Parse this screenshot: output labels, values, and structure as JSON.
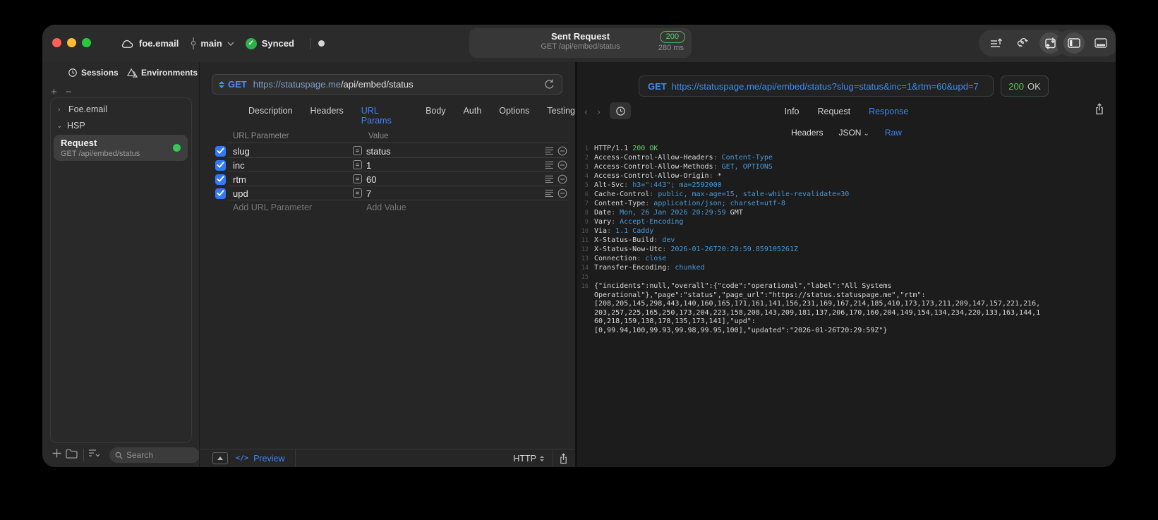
{
  "titlebar": {
    "project": "foe.email",
    "branch": "main",
    "sync": "Synced",
    "request_title": "Sent Request",
    "request_subtitle": "GET /api/embed/status",
    "status_code": "200",
    "duration": "280 ms"
  },
  "sidebar": {
    "tabs": [
      {
        "label": "Sessions",
        "active": true
      },
      {
        "label": "Environments",
        "active": false
      }
    ],
    "tree": {
      "collapsed_item": "Foe.email",
      "expanded_item": "HSP",
      "request": {
        "title": "Request",
        "subtitle": "GET /api/embed/status"
      }
    },
    "search_placeholder": "Search"
  },
  "request_editor": {
    "method": "GET",
    "url_host": "https://statuspage.me",
    "url_path": "/api/embed/status",
    "tabs": [
      {
        "label": "Description"
      },
      {
        "label": "Headers"
      },
      {
        "label": "URL Params",
        "active": true
      },
      {
        "label": "Body"
      },
      {
        "label": "Auth"
      },
      {
        "label": "Options"
      },
      {
        "label": "Testing"
      }
    ],
    "params": {
      "col_name": "URL Parameter",
      "col_value": "Value",
      "rows": [
        {
          "name": "slug",
          "value": "status",
          "checked": true
        },
        {
          "name": "inc",
          "value": "1",
          "checked": true
        },
        {
          "name": "rtm",
          "value": "60",
          "checked": true
        },
        {
          "name": "upd",
          "value": "7",
          "checked": true
        }
      ],
      "add_name": "Add URL Parameter",
      "add_value": "Add Value"
    },
    "footer": {
      "code_glyph": "</>",
      "preview": "Preview",
      "protocol": "HTTP"
    }
  },
  "response_viewer": {
    "method": "GET",
    "url": "https://statuspage.me/api/embed/status?slug=status&inc=1&rtm=60&upd=7",
    "status_code": "200",
    "status_text": "OK",
    "tabs": [
      {
        "label": "Info"
      },
      {
        "label": "Request"
      },
      {
        "label": "Response",
        "active": true
      }
    ],
    "view_tabs": [
      {
        "label": "Headers"
      },
      {
        "label": "JSON",
        "chevron": true
      },
      {
        "label": "Raw",
        "active": true
      }
    ],
    "lines": [
      {
        "n": "1",
        "parts": [
          [
            "p",
            "HTTP/1.1 "
          ],
          [
            "g",
            "200 OK"
          ]
        ]
      },
      {
        "n": "2",
        "parts": [
          [
            "p",
            "Access-Control-Allow-Headers"
          ],
          [
            "d",
            ": "
          ],
          [
            "b",
            "Content-Type"
          ]
        ]
      },
      {
        "n": "3",
        "parts": [
          [
            "p",
            "Access-Control-Allow-Methods"
          ],
          [
            "d",
            ": "
          ],
          [
            "b",
            "GET, OPTIONS"
          ]
        ]
      },
      {
        "n": "4",
        "parts": [
          [
            "p",
            "Access-Control-Allow-Origin"
          ],
          [
            "d",
            ": "
          ],
          [
            "p",
            "*"
          ]
        ]
      },
      {
        "n": "5",
        "parts": [
          [
            "p",
            "Alt-Svc"
          ],
          [
            "d",
            ": "
          ],
          [
            "b",
            "h3=\":443\"; ma=2592000"
          ]
        ]
      },
      {
        "n": "6",
        "parts": [
          [
            "p",
            "Cache-Control"
          ],
          [
            "d",
            ": "
          ],
          [
            "b",
            "public, max-age=15, stale-while-revalidate=30"
          ]
        ]
      },
      {
        "n": "7",
        "parts": [
          [
            "p",
            "Content-Type"
          ],
          [
            "d",
            ": "
          ],
          [
            "b",
            "application/json; charset=utf-8"
          ]
        ]
      },
      {
        "n": "8",
        "parts": [
          [
            "p",
            "Date"
          ],
          [
            "d",
            ": "
          ],
          [
            "b",
            "Mon, 26 Jan 2026 20:29:59"
          ],
          [
            "p",
            " GMT"
          ]
        ]
      },
      {
        "n": "9",
        "parts": [
          [
            "p",
            "Vary"
          ],
          [
            "d",
            ": "
          ],
          [
            "b",
            "Accept-Encoding"
          ]
        ]
      },
      {
        "n": "10",
        "parts": [
          [
            "p",
            "Via"
          ],
          [
            "d",
            ": "
          ],
          [
            "b",
            "1.1 Caddy"
          ]
        ]
      },
      {
        "n": "11",
        "parts": [
          [
            "p",
            "X-Status-Build"
          ],
          [
            "d",
            ": "
          ],
          [
            "b",
            "dev"
          ]
        ]
      },
      {
        "n": "12",
        "parts": [
          [
            "p",
            "X-Status-Now-Utc"
          ],
          [
            "d",
            ": "
          ],
          [
            "b",
            "2026-01-26T20:29:59.859105261Z"
          ]
        ]
      },
      {
        "n": "13",
        "parts": [
          [
            "p",
            "Connection"
          ],
          [
            "d",
            ": "
          ],
          [
            "b",
            "close"
          ]
        ]
      },
      {
        "n": "14",
        "parts": [
          [
            "p",
            "Transfer-Encoding"
          ],
          [
            "d",
            ": "
          ],
          [
            "b",
            "chunked"
          ]
        ]
      },
      {
        "n": "15",
        "parts": []
      },
      {
        "n": "16",
        "wrap": [
          "{\"incidents\":null,\"overall\":{\"code\":\"operational\",\"label\":\"All Systems",
          "Operational\"},\"page\":\"status\",\"page_url\":\"https://status.statuspage.me\",\"rtm\":",
          "[208,205,145,298,443,140,160,165,171,161,141,156,231,169,167,214,185,410,173,173,211,209,147,157,221,216,",
          "203,257,225,165,250,173,204,223,158,208,143,209,181,137,206,170,160,204,149,154,134,234,220,133,163,144,1",
          "60,218,159,138,178,135,173,141],\"upd\":",
          "[0,99.94,100,99.93,99.98,99.95,100],\"updated\":\"2026-01-26T20:29:59Z\"}"
        ]
      }
    ]
  },
  "colors": {
    "accent_blue": "#3e82f7",
    "code_value_blue": "#4798d8",
    "success_green": "#55c95d",
    "checkbox_blue": "#3478f6"
  }
}
